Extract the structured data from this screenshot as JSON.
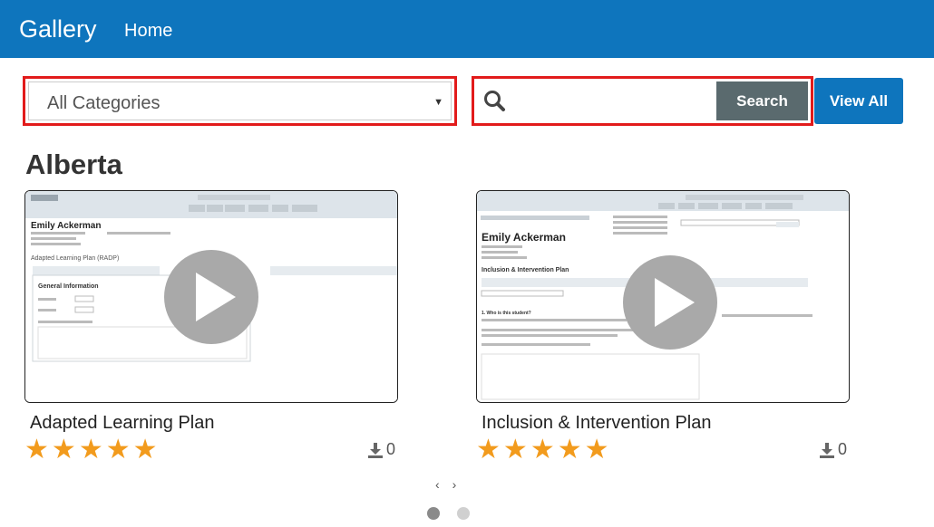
{
  "navbar": {
    "brand": "Gallery",
    "home": "Home"
  },
  "filter": {
    "category_value": "All Categories",
    "search_placeholder": "",
    "search_label": "Search",
    "view_all_label": "View All"
  },
  "section": {
    "title": "Alberta"
  },
  "cards": [
    {
      "title": "Adapted Learning Plan",
      "rating": 5,
      "downloads": "0",
      "thumb": {
        "student_name": "Emily Ackerman",
        "plan_title": "Adapted Learning Plan (RADP)",
        "panel_heading": "General Information"
      }
    },
    {
      "title": "Inclusion & Intervention Plan",
      "rating": 5,
      "downloads": "0",
      "thumb": {
        "student_name": "Emily Ackerman",
        "plan_title": "Inclusion & Intervention Plan",
        "panel_heading": "1. Who is this student?"
      }
    }
  ],
  "pager": {
    "prev": "‹",
    "next": "›",
    "pages": 2,
    "active": 0
  },
  "colors": {
    "navbar": "#0e75bd",
    "highlight_border": "#e21b1b",
    "search_button": "#5a6a6e",
    "star": "#f29b1d"
  },
  "icons": {
    "search": "magnifier-icon",
    "download": "download-icon",
    "play": "play-icon",
    "star": "star-icon"
  }
}
